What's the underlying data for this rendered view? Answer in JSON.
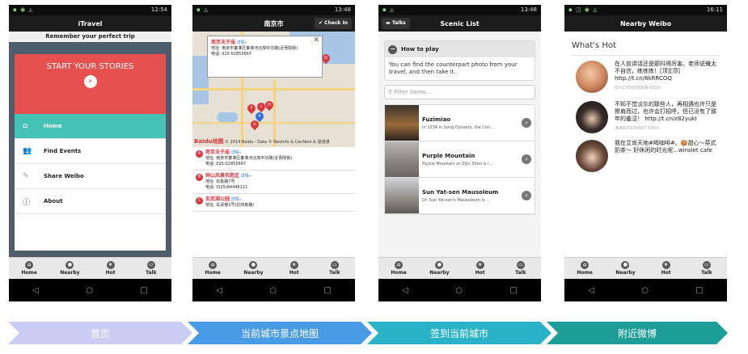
{
  "phones": [
    {
      "status_time": "12:54",
      "title": "iTravel",
      "subtitle": "Remember your perfect trip",
      "hero_text": "START YOUR STORIES",
      "menu": [
        {
          "label": "Home",
          "icon": "home-icon",
          "active": true
        },
        {
          "label": "Find Events",
          "icon": "people-icon",
          "active": false
        },
        {
          "label": "Share Weibo",
          "icon": "edit-icon",
          "active": false
        },
        {
          "label": "About",
          "icon": "info-icon",
          "active": false
        }
      ]
    },
    {
      "status_time": "13:48",
      "title": "南京市",
      "checkin_label": "Check In",
      "popup": {
        "name": "南京夫子庙",
        "link": "详情»",
        "address": "地址:  南京市秦淮区秦淮河北岸中华路(近贡院街)",
        "phone": "电话:  025-52855667"
      },
      "map_logo": "Baidu地图",
      "map_copyright": "© 2014 Baidu - Data © NavInfo & CenNavi & 道道通",
      "places": [
        {
          "marker": "A",
          "name": "南京夫子庙",
          "link": "详情»",
          "address": "地址:  南京市秦淮区秦淮河北岸中华路(近贡院街)",
          "phone": "电话:  025-52855667"
        },
        {
          "marker": "B",
          "name": "钟山风景名胜区",
          "link": "详情»",
          "address": "地址:  石象路7号",
          "phone": "电话:  (025)84446111"
        },
        {
          "marker": "C",
          "name": "玄武湖公园",
          "link": "详情»",
          "address": "地址:  玄武巷1号(近四象路)",
          "phone": ""
        }
      ]
    },
    {
      "status_time": "13:48",
      "title": "Scenic List",
      "talks_label": "Talks",
      "howto_title": "How to play",
      "howto_body": "You can find the counterpart photo from your travel, and then take it.",
      "filter_placeholder": "Filter items...",
      "items": [
        {
          "title": "Fuzimiao",
          "desc": "In 1034 in Song Dynasty, the Con..."
        },
        {
          "title": "Purple Mountain",
          "desc": "Purple Mountain or Zijin Shan is l..."
        },
        {
          "title": "Sun Yat-sen Mausoleum",
          "desc": "Dr. Sun Yat-sen's Mausoleum is ..."
        }
      ]
    },
    {
      "status_time": "16:11",
      "title": "Nearby Weibo",
      "section_title": "What's Hot",
      "posts": [
        {
          "text": "在人前讲话还是颤抖得厉害。老师说俺太不自信，练练练！[顶][顶] http://t.cn/8kRRCOQ",
          "meta": "旧人CY的旧城旧事 600m"
        },
        {
          "text": "不知不觉淡忘的那些人，再相遇也许只是擦肩而过，也许会打招呼，但已没有了那年的羞涩！ http://t.cn/z82yukI",
          "meta": "海淘825936697 700m"
        },
        {
          "text": "我在艾尚天地#喝咖啡#。🍪甜心～英式奶茶～ 好休闲的时光呢...winslet cafe",
          "meta": ""
        }
      ]
    }
  ],
  "tabbar": [
    {
      "label": "Home",
      "icon": "home-icon"
    },
    {
      "label": "Nearby",
      "icon": "location-icon"
    },
    {
      "label": "Hot",
      "icon": "star-icon"
    },
    {
      "label": "Talk",
      "icon": "chat-icon"
    }
  ],
  "steps": [
    "首页",
    "当前城市景点地图",
    "签到当前城市",
    "附近微博"
  ],
  "colors": {
    "hero_red": "#e6514f",
    "menu_active": "#44c2b6",
    "step_colors": [
      "#c9cdf3",
      "#4a9be6",
      "#2ab3c8",
      "#1d9e96"
    ]
  }
}
